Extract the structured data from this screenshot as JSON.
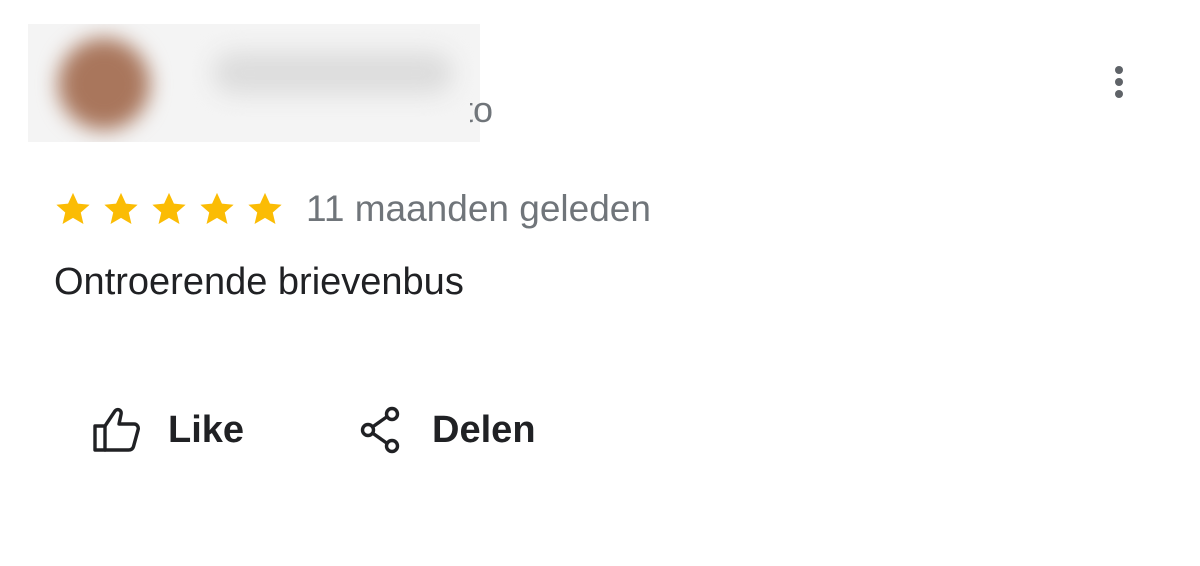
{
  "review": {
    "author_subtitle_visible": "to",
    "rating": 5,
    "rating_max": 5,
    "star_color": "#fbbc04",
    "date": "11 maanden geleden",
    "text": "Ontroerende brievenbus",
    "more_icon": "more-vert-icon"
  },
  "actions": {
    "like_label": "Like",
    "like_icon": "thumb-up-icon",
    "share_label": "Delen",
    "share_icon": "share-icon"
  },
  "colors": {
    "text_primary": "#202124",
    "text_secondary": "#70757a",
    "icon": "#5f6368"
  }
}
